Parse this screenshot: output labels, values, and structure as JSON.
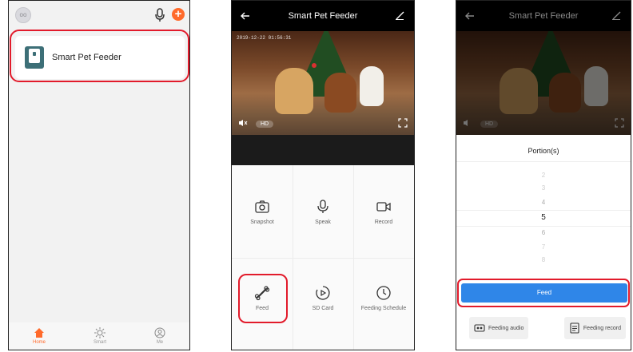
{
  "phone1": {
    "avatar_text": "oo",
    "device_name": "Smart Pet Feeder",
    "tabs": [
      {
        "label": "Home",
        "icon": "home-icon",
        "active": true
      },
      {
        "label": "Smart",
        "icon": "smart-icon",
        "active": false
      },
      {
        "label": "Me",
        "icon": "me-icon",
        "active": false
      }
    ],
    "accent": "#ff6a2b"
  },
  "phone2": {
    "title": "Smart Pet Feeder",
    "timestamp": "2019-12-22 01:56:31",
    "hd_label": "HD",
    "actions": [
      {
        "label": "Snapshot",
        "icon": "camera-icon"
      },
      {
        "label": "Speak",
        "icon": "microphone-icon"
      },
      {
        "label": "Record",
        "icon": "video-record-icon"
      },
      {
        "label": "Feed",
        "icon": "bone-icon"
      },
      {
        "label": "SD Card",
        "icon": "playback-icon"
      },
      {
        "label": "Feeding Schedule",
        "icon": "clock-icon"
      }
    ]
  },
  "phone3": {
    "title": "Smart Pet Feeder",
    "hd_label": "HD",
    "portion_title": "Portion(s)",
    "picker_values": [
      "2",
      "3",
      "4",
      "5",
      "6",
      "7",
      "8"
    ],
    "selected_value": "5",
    "feed_button": "Feed",
    "feeding_audio": "Feeding audio",
    "feeding_record": "Feeding record",
    "button_color": "#2f86e8"
  },
  "highlight_color": "#e21b2b"
}
